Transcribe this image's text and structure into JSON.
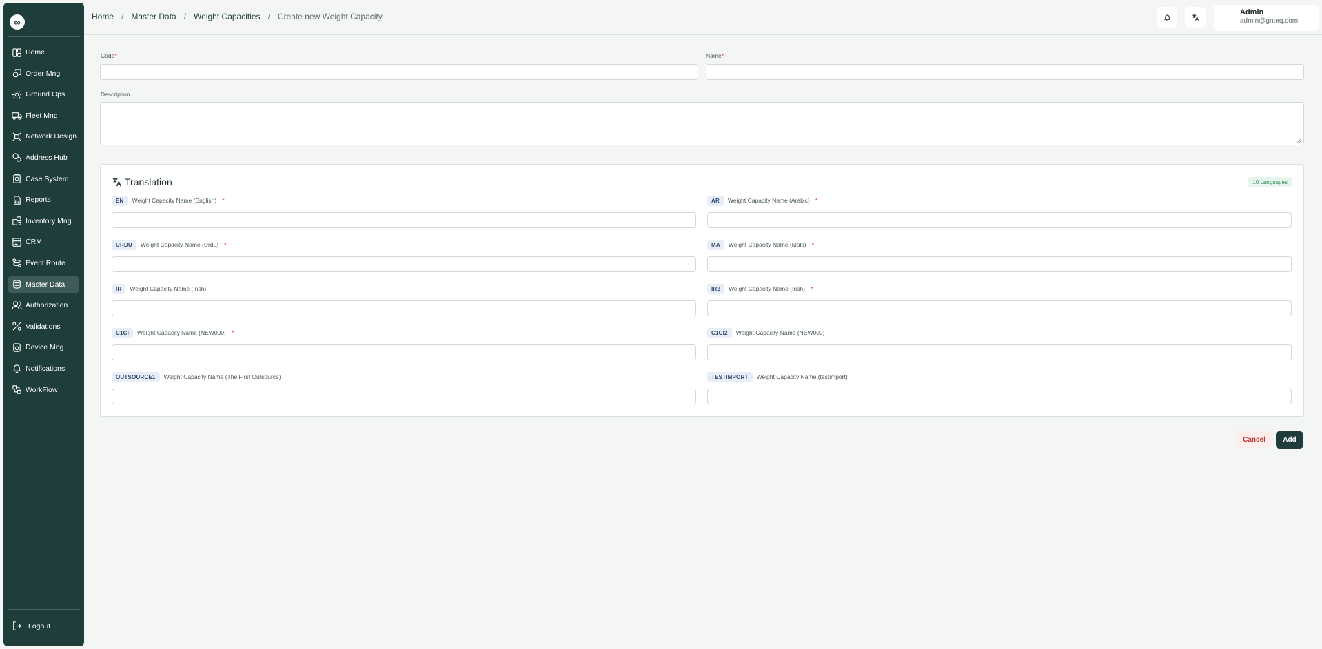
{
  "sidebar": {
    "logo": "∞",
    "items": [
      {
        "label": "Home",
        "icon": "home-icon"
      },
      {
        "label": "Order Mng",
        "icon": "order-icon"
      },
      {
        "label": "Ground Ops",
        "icon": "ground-ops-icon"
      },
      {
        "label": "Fleet Mng",
        "icon": "truck-icon"
      },
      {
        "label": "Network Design",
        "icon": "network-icon"
      },
      {
        "label": "Address Hub",
        "icon": "address-icon"
      },
      {
        "label": "Case System",
        "icon": "case-icon"
      },
      {
        "label": "Reports",
        "icon": "report-icon"
      },
      {
        "label": "Inventory Mng",
        "icon": "inventory-icon"
      },
      {
        "label": "CRM",
        "icon": "crm-icon"
      },
      {
        "label": "Event Route",
        "icon": "route-icon"
      },
      {
        "label": "Master Data",
        "icon": "database-icon",
        "active": true
      },
      {
        "label": "Authorization",
        "icon": "users-icon"
      },
      {
        "label": "Validations",
        "icon": "validation-icon"
      },
      {
        "label": "Device Mng",
        "icon": "device-icon"
      },
      {
        "label": "Notifications",
        "icon": "bell-icon"
      },
      {
        "label": "WorkFlow",
        "icon": "workflow-icon"
      }
    ],
    "logout_label": "Logout"
  },
  "header": {
    "breadcrumb": {
      "home": "Home",
      "master_data": "Master Data",
      "weight_capacities": "Weight Capacities",
      "current": "Create new Weight Capacity",
      "separator": "/"
    },
    "user": {
      "name": "Admin",
      "email": "admin@gnteq.com"
    }
  },
  "form": {
    "code_label": "Code",
    "name_label": "Name",
    "description_label": "Description",
    "required_mark": "*",
    "code_value": "",
    "name_value": "",
    "description_value": ""
  },
  "translation": {
    "title": "Translation",
    "badge": "10 Languages",
    "fields": [
      {
        "code": "EN",
        "label": "Weight Capacity Name (English)",
        "required": "*"
      },
      {
        "code": "AR",
        "label": "Weight Capacity Name (Arabic)",
        "required": "*"
      },
      {
        "code": "URDU",
        "label": "Weight Capacity Name (Urdu)",
        "required": "*"
      },
      {
        "code": "MA",
        "label": "Weight Capacity Name (Malti)",
        "required": "*"
      },
      {
        "code": "IR",
        "label": "Weight Capacity Name (Irish)",
        "required": ""
      },
      {
        "code": "IR2",
        "label": "Weight Capacity Name (Irish)",
        "required": "*"
      },
      {
        "code": "C1CI",
        "label": "Weight Capacity Name (NEW000)",
        "required": "*"
      },
      {
        "code": "C1CI2",
        "label": "Weight Capacity Name (NEW000)",
        "required": ""
      },
      {
        "code": "OUTSOURCE1",
        "label": "Weight Capacity Name (The First Outsource)",
        "required": ""
      },
      {
        "code": "TESTIMPORT",
        "label": "Weight Capacity Name (testimport)",
        "required": ""
      }
    ]
  },
  "actions": {
    "cancel_label": "Cancel",
    "add_label": "Add"
  },
  "colors": {
    "sidebar": "#1e3d3b",
    "primary": "#1e3d3b",
    "danger": "#c4342e",
    "badge": "#2e8b57"
  }
}
